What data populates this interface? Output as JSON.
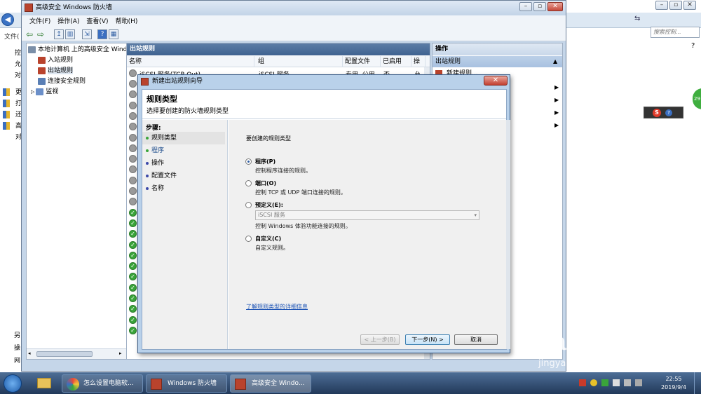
{
  "background": {
    "search_placeholder": "搜索控制...",
    "left_chars": [
      "文件(",
      "控",
      "允",
      "对",
      "更",
      "打",
      "还",
      "高",
      "对",
      "另",
      "操",
      "网"
    ],
    "left_label": "文件("
  },
  "mmc": {
    "title": "高级安全 Windows 防火墙",
    "menu": [
      "文件(F)",
      "操作(A)",
      "查看(V)",
      "帮助(H)"
    ],
    "tree": {
      "root": "本地计算机 上的高级安全 Windo",
      "items": [
        "入站规则",
        "出站规则",
        "连接安全规则",
        "监视"
      ]
    },
    "center": {
      "header": "出站规则",
      "columns": [
        "名称",
        "组",
        "配置文件",
        "已启用",
        "操"
      ],
      "first_row": {
        "name": "iSCSI 服务(TCP-Out)",
        "group": "iSCSI 服务",
        "profile": "专用, 公用",
        "enabled": "否",
        "action": "允"
      },
      "gray_rows": 12,
      "green_rows": 12
    },
    "actions": {
      "header": "操作",
      "section": "出站规则",
      "first_item": "新建规则..."
    }
  },
  "dialog": {
    "title": "新建出站规则向导",
    "heading": "规则类型",
    "subheading": "选择要创建的防火墙规则类型",
    "steps_label": "步骤:",
    "steps": [
      "规则类型",
      "程序",
      "操作",
      "配置文件",
      "名称"
    ],
    "prompt": "要创建的规则类型",
    "options": [
      {
        "label": "程序(P)",
        "desc": "控制程序连接的规则。",
        "selected": true
      },
      {
        "label": "端口(O)",
        "desc": "控制 TCP 或 UDP 端口连接的规则。",
        "selected": false
      },
      {
        "label": "预定义(E):",
        "desc": "控制 Windows 体验功能连接的规则。",
        "selected": false
      },
      {
        "label": "自定义(C)",
        "desc": "自定义规则。",
        "selected": false
      }
    ],
    "predefined_select": "iSCSI 服务",
    "learn_more": "了解规则类型的详细信息",
    "buttons": {
      "back": "< 上一步(B)",
      "next": "下一步(N) >",
      "cancel": "取消"
    }
  },
  "taskbar": {
    "tasks": [
      "怎么设置电脑软...",
      "Windows 防火墙",
      "高级安全 Windo..."
    ],
    "time": "22:55",
    "date": "2019/9/4"
  },
  "watermark": {
    "brand": "Bai",
    "brand2": "du",
    "cn": "经验",
    "url": "jingyan.baidu.com"
  },
  "badge": "29"
}
